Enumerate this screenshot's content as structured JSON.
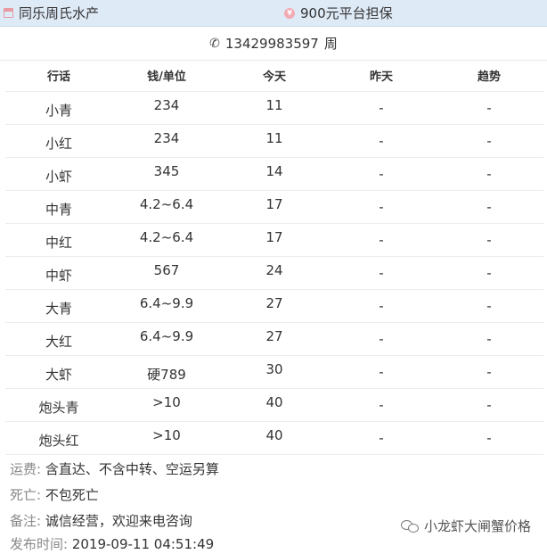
{
  "topbar": {
    "shop_name": "同乐周氏水产",
    "guarantee": "900元平台担保"
  },
  "contact": {
    "phone": "13429983597",
    "surname": "周"
  },
  "table": {
    "headers": [
      "行话",
      "钱/单位",
      "今天",
      "昨天",
      "趋势"
    ],
    "rows": [
      {
        "name": "小青",
        "price": "234",
        "today": "11",
        "yesterday": "-",
        "trend": "-"
      },
      {
        "name": "小红",
        "price": "234",
        "today": "11",
        "yesterday": "-",
        "trend": "-"
      },
      {
        "name": "小虾",
        "price": "345",
        "today": "14",
        "yesterday": "-",
        "trend": "-"
      },
      {
        "name": "中青",
        "price": "4.2~6.4",
        "today": "17",
        "yesterday": "-",
        "trend": "-"
      },
      {
        "name": "中红",
        "price": "4.2~6.4",
        "today": "17",
        "yesterday": "-",
        "trend": "-"
      },
      {
        "name": "中虾",
        "price": "567",
        "today": "24",
        "yesterday": "-",
        "trend": "-"
      },
      {
        "name": "大青",
        "price": "6.4~9.9",
        "today": "27",
        "yesterday": "-",
        "trend": "-"
      },
      {
        "name": "大红",
        "price": "6.4~9.9",
        "today": "27",
        "yesterday": "-",
        "trend": "-"
      },
      {
        "name": "大虾",
        "price": "硬789",
        "today": "30",
        "yesterday": "-",
        "trend": "-"
      },
      {
        "name": "炮头青",
        "price": ">10",
        "today": "40",
        "yesterday": "-",
        "trend": "-"
      },
      {
        "name": "炮头红",
        "price": ">10",
        "today": "40",
        "yesterday": "-",
        "trend": "-"
      }
    ]
  },
  "notes": {
    "shipping_label": "运费:",
    "shipping_value": "含直达、不含中转、空运另算",
    "death_label": "死亡:",
    "death_value": "不包死亡",
    "remark_label": "备注:",
    "remark_value": "诚信经营，欢迎来电咨询",
    "publish_label": "发布时间:",
    "publish_value": "2019-09-11  04:51:49"
  },
  "watermark": {
    "text": "小龙虾大闸蟹价格"
  }
}
